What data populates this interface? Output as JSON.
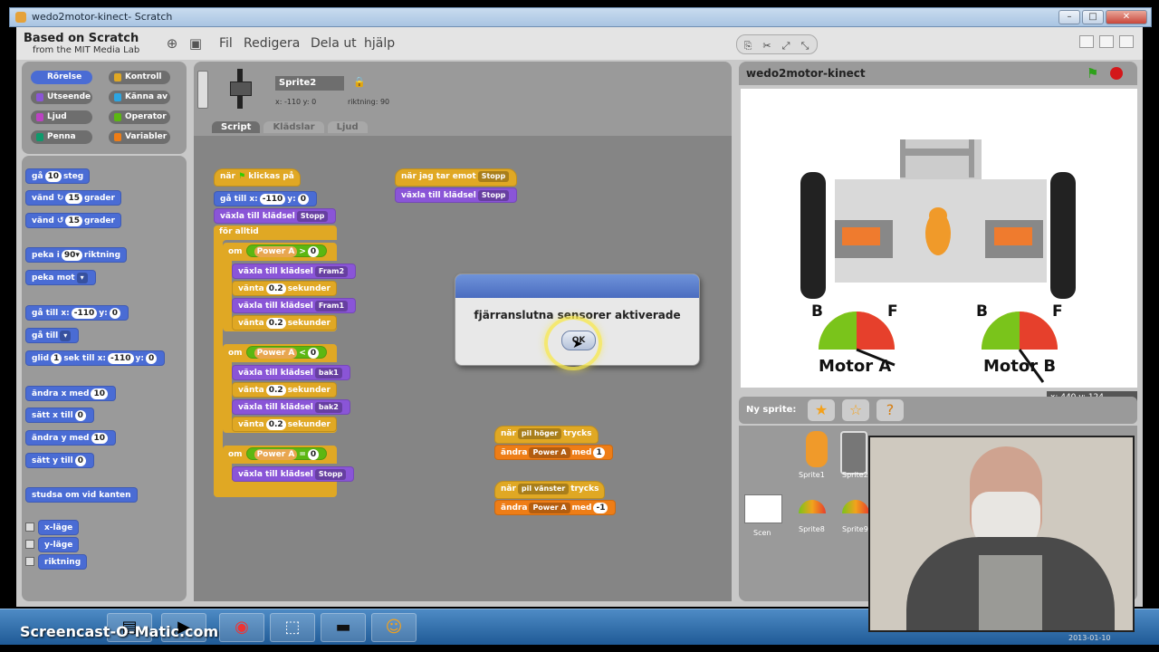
{
  "window": {
    "title": "wedo2motor-kinect- Scratch"
  },
  "logo": {
    "line1": "Based on Scratch",
    "line2": "from the MIT Media Lab"
  },
  "menu": [
    "Fil",
    "Redigera",
    "Dela ut",
    "hjälp"
  ],
  "categories": [
    {
      "label": "Rörelse",
      "color": "#4a6cd4"
    },
    {
      "label": "Kontroll",
      "color": "#e0a824"
    },
    {
      "label": "Utseende",
      "color": "#8a55d7"
    },
    {
      "label": "Känna av",
      "color": "#2ca5e2"
    },
    {
      "label": "Ljud",
      "color": "#bb42c3"
    },
    {
      "label": "Operator",
      "color": "#5cb712"
    },
    {
      "label": "Penna",
      "color": "#0e9a6c"
    },
    {
      "label": "Variabler",
      "color": "#ee7d16"
    }
  ],
  "palette": {
    "b1": {
      "a": "gå",
      "v": "10",
      "b": "steg"
    },
    "b2": {
      "a": "vänd",
      "v": "15",
      "b": "grader"
    },
    "b3": {
      "a": "vänd",
      "v": "15",
      "b": "grader"
    },
    "b4": {
      "a": "peka i",
      "v": "90▾",
      "b": "riktning"
    },
    "b5": {
      "a": "peka mot"
    },
    "b6": {
      "a": "gå till x:",
      "x": "-110",
      "b": "y:",
      "y": "0"
    },
    "b7": {
      "a": "gå till"
    },
    "b8": {
      "a": "glid",
      "s": "1",
      "b": "sek till x:",
      "x": "-110",
      "c": "y:",
      "y": "0"
    },
    "b9": {
      "a": "ändra x med",
      "v": "10"
    },
    "b10": {
      "a": "sätt x till",
      "v": "0"
    },
    "b11": {
      "a": "ändra y med",
      "v": "10"
    },
    "b12": {
      "a": "sätt y till",
      "v": "0"
    },
    "b13": {
      "a": "studsa om vid kanten"
    },
    "r1": "x-läge",
    "r2": "y-läge",
    "r3": "riktning"
  },
  "sprite": {
    "name": "Sprite2",
    "x_label": "x: -110  y: 0",
    "dir_label": "riktning: 90"
  },
  "tabs": [
    "Script",
    "Klädslar",
    "Ljud"
  ],
  "script1": {
    "hat": {
      "a": "när",
      "b": "klickas på"
    },
    "goto": {
      "a": "gå till x:",
      "x": "-110",
      "b": "y:",
      "y": "0"
    },
    "costume0": {
      "a": "växla till klädsel",
      "v": "Stopp"
    },
    "forever": "för alltid",
    "if1": {
      "a": "om",
      "sensor": "Power A",
      "op": ">",
      "v": "0"
    },
    "s1": {
      "a": "växla till klädsel",
      "v": "Fram2"
    },
    "w1": {
      "a": "vänta",
      "v": "0.2",
      "b": "sekunder"
    },
    "s2": {
      "a": "växla till klädsel",
      "v": "Fram1"
    },
    "w2": {
      "a": "vänta",
      "v": "0.2",
      "b": "sekunder"
    },
    "if2": {
      "a": "om",
      "sensor": "Power A",
      "op": "<",
      "v": "0"
    },
    "s3": {
      "a": "växla till klädsel",
      "v": "bak1"
    },
    "w3": {
      "a": "vänta",
      "v": "0.2",
      "b": "sekunder"
    },
    "s4": {
      "a": "växla till klädsel",
      "v": "bak2"
    },
    "w4": {
      "a": "vänta",
      "v": "0.2",
      "b": "sekunder"
    },
    "if3": {
      "a": "om",
      "sensor": "Power A",
      "op": "=",
      "v": "0"
    },
    "s5": {
      "a": "växla till klädsel",
      "v": "Stopp"
    }
  },
  "script2": {
    "hat": {
      "a": "när jag tar emot",
      "v": "Stopp"
    },
    "body": {
      "a": "växla till klädsel",
      "v": "Stopp"
    }
  },
  "script3": {
    "hat": {
      "a": "när",
      "v": "pil höger",
      "b": "trycks"
    },
    "body": {
      "a": "ändra",
      "v": "Power A",
      "b": "med",
      "n": "1"
    }
  },
  "script4": {
    "hat": {
      "a": "när",
      "v": "pil vänster",
      "b": "trycks"
    },
    "body": {
      "a": "ändra",
      "v": "Power A",
      "b": "med",
      "n": "-1"
    }
  },
  "dialog": {
    "message": "fjärranslutna sensorer aktiverade",
    "ok": "OK"
  },
  "stage": {
    "title": "wedo2motor-kinect",
    "coords": "x: 440  y: 124"
  },
  "gauges": [
    {
      "b": "B",
      "f": "F",
      "label": "Motor A"
    },
    {
      "b": "B",
      "f": "F",
      "label": "Motor B"
    }
  ],
  "newsprite": {
    "label": "Ny sprite:"
  },
  "sprites": [
    "Sprite1",
    "Sprite2",
    "Sprite8",
    "Sprite9"
  ],
  "scene": "Scen",
  "watermark": "Screencast-O-Matic.com",
  "clock": "2013-01-10"
}
